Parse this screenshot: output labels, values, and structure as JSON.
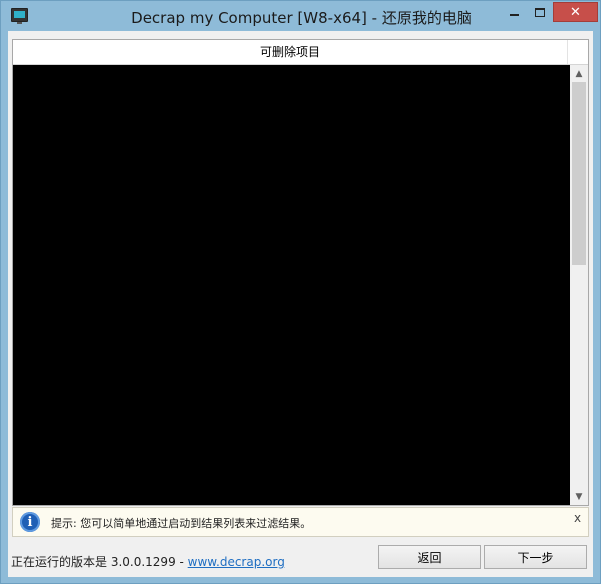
{
  "window": {
    "title": "Decrap my Computer [W8-x64] - 还原我的电脑",
    "close_glyph": "✕"
  },
  "list": {
    "column_header": "可删除项目",
    "scroll_up": "▲",
    "scroll_down": "▼"
  },
  "hint": {
    "icon_glyph": "i",
    "text": "提示: 您可以简单地通过启动到结果列表来过滤结果。",
    "close": "x"
  },
  "footer": {
    "version_prefix": "正在运行的版本是 3.0.0.1299 - ",
    "version_link": "www.decrap.org",
    "back_label": "返回",
    "next_label": "下一步"
  }
}
